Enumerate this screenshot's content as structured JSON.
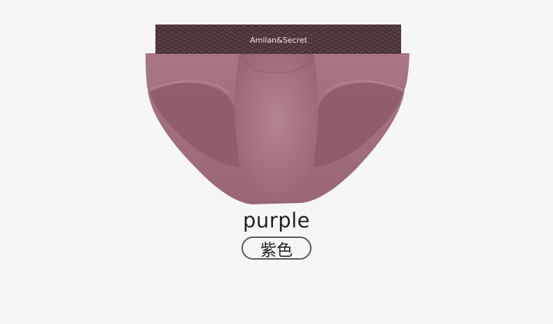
{
  "product": {
    "brand_label": "Amilan&Secret",
    "color_name_en": "purple",
    "color_name_zh": "紫色",
    "fabric_color": "#a4707d",
    "waistband_color": "#5a3f45"
  }
}
